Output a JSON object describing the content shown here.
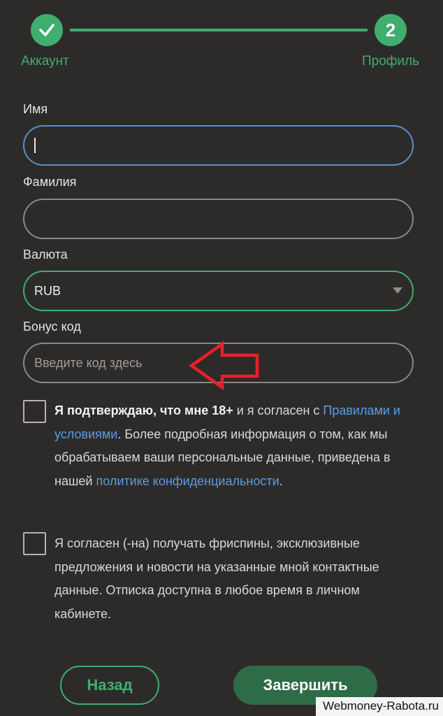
{
  "stepper": {
    "step1_label": "Аккаунт",
    "step2_number": "2",
    "step2_label": "Профиль"
  },
  "form": {
    "first_name": {
      "label": "Имя",
      "value": ""
    },
    "last_name": {
      "label": "Фамилия",
      "value": ""
    },
    "currency": {
      "label": "Валюта",
      "value": "RUB"
    },
    "bonus_code": {
      "label": "Бонус код",
      "placeholder": "Введите код здесь"
    }
  },
  "consent": {
    "age_bold": "Я подтверждаю, что мне 18+",
    "age_text1": " и я согласен с ",
    "rules_link": "Правилами и условиями",
    "age_text2": ". Более подробная информация о том, как мы обрабатываем ваши персональные данные, приведена в нашей ",
    "privacy_link": "политике конфиденциальности",
    "age_text3": ".",
    "marketing": "Я согласен (-на) получать фриспины, эксклюзивные предложения и новости на указанные мной контактные данные. Отписка доступна в любое время в личном кабинете."
  },
  "buttons": {
    "back": "Назад",
    "finish": "Завершить"
  },
  "watermark": "Webmoney-Rabota.ru",
  "colors": {
    "accent": "#3fae6f",
    "background": "#2d2b2a",
    "link": "#5b9be0",
    "focus_border": "#5a8fd0",
    "annotation": "#e8202a"
  }
}
